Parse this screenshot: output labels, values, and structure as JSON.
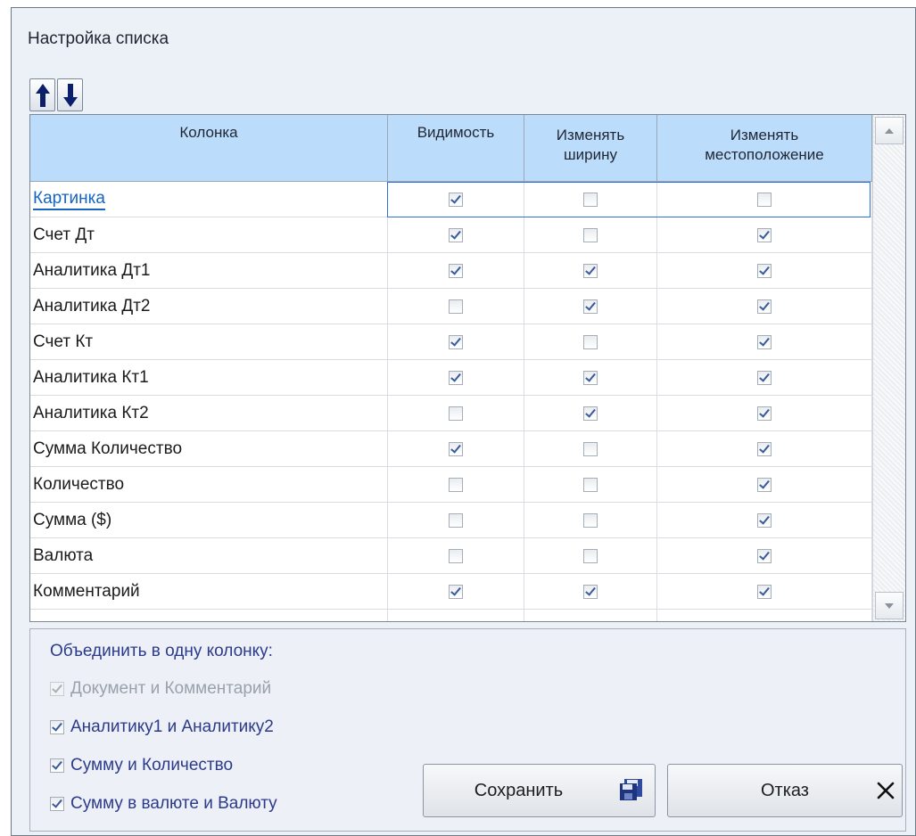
{
  "window": {
    "title": "Настройка списка"
  },
  "toolbar": {
    "up_icon": "arrow-up-icon",
    "down_icon": "arrow-down-icon"
  },
  "grid": {
    "headers": {
      "column": "Колонка",
      "visibility": "Видимость",
      "resize_line1": "Изменять",
      "resize_line2": "ширину",
      "move_line1": "Изменять",
      "move_line2": "местоположение"
    },
    "rows": [
      {
        "name": "Картинка",
        "visible": true,
        "resize": false,
        "move": false,
        "selected": true
      },
      {
        "name": "Счет Дт",
        "visible": true,
        "resize": false,
        "move": true
      },
      {
        "name": "Аналитика Дт1",
        "visible": true,
        "resize": true,
        "move": true
      },
      {
        "name": "Аналитика Дт2",
        "visible": false,
        "resize": true,
        "move": true
      },
      {
        "name": "Счет Кт",
        "visible": true,
        "resize": false,
        "move": true
      },
      {
        "name": "Аналитика Кт1",
        "visible": true,
        "resize": true,
        "move": true
      },
      {
        "name": "Аналитика Кт2",
        "visible": false,
        "resize": true,
        "move": true
      },
      {
        "name": "Сумма Количество",
        "visible": true,
        "resize": false,
        "move": true
      },
      {
        "name": "Количество",
        "visible": false,
        "resize": false,
        "move": true
      },
      {
        "name": "Сумма ($)",
        "visible": false,
        "resize": false,
        "move": true
      },
      {
        "name": "Валюта",
        "visible": false,
        "resize": false,
        "move": true
      },
      {
        "name": "Комментарий",
        "visible": true,
        "resize": true,
        "move": true
      }
    ]
  },
  "merge": {
    "title": "Объединить в одну колонку:",
    "options": [
      {
        "label": "Документ и Комментарий",
        "checked": true,
        "enabled": false
      },
      {
        "label": "Аналитику1 и Аналитику2",
        "checked": true,
        "enabled": true
      },
      {
        "label": "Сумму и Количество",
        "checked": true,
        "enabled": true
      },
      {
        "label": "Сумму в валюте и Валюту",
        "checked": true,
        "enabled": true
      }
    ]
  },
  "buttons": {
    "save": "Сохранить",
    "cancel": "Отказ",
    "save_icon": "floppy-disk-icon",
    "cancel_icon": "close-icon"
  }
}
